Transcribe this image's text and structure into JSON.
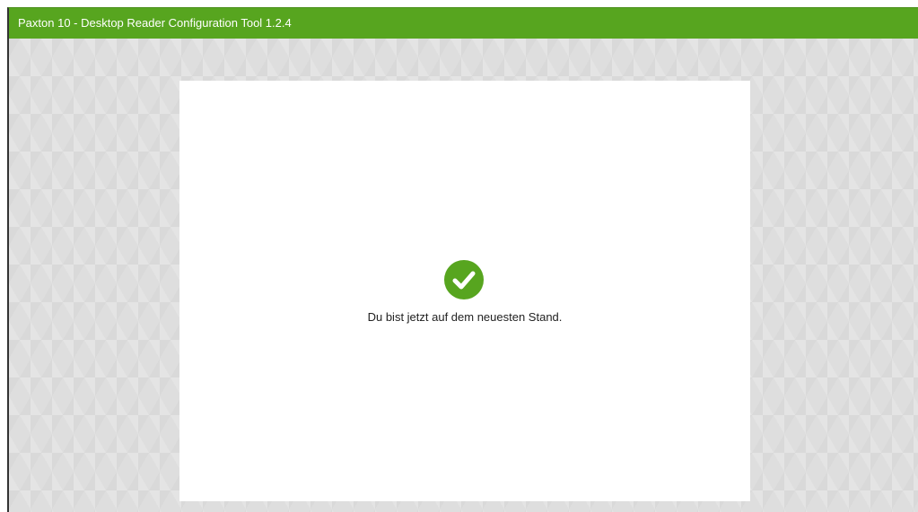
{
  "window": {
    "title": "Paxton 10 - Desktop Reader Configuration Tool 1.2.4"
  },
  "status": {
    "icon": "check-circle-icon",
    "message": "Du bist jetzt auf dem neuesten Stand."
  },
  "colors": {
    "accent": "#57a51f",
    "background": "#dedede",
    "card": "#ffffff"
  }
}
